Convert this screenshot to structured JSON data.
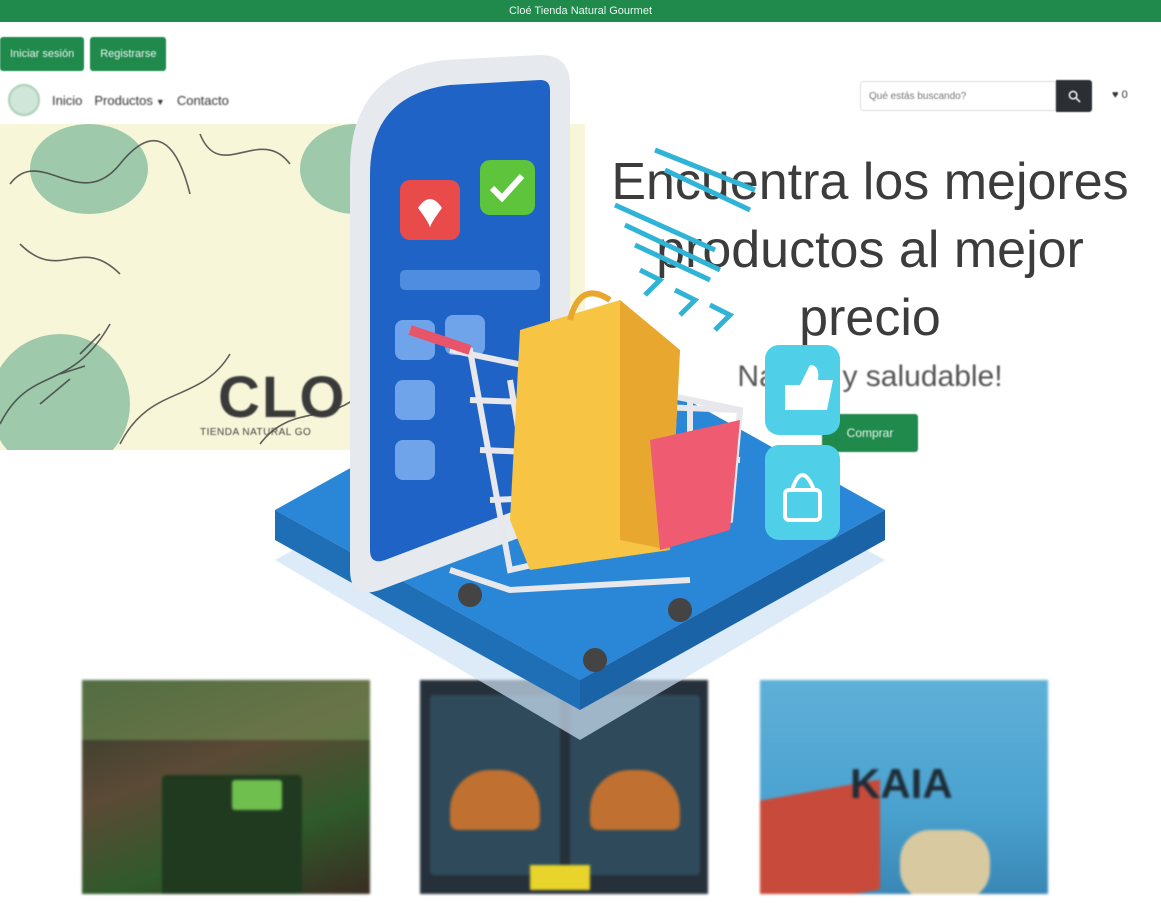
{
  "topbar": {
    "text": "Cloé Tienda Natural Gourmet"
  },
  "auth": {
    "login_label": "Iniciar sesión",
    "register_label": "Registrarse"
  },
  "nav": {
    "items": [
      {
        "label": "Inicio"
      },
      {
        "label": "Productos",
        "has_dropdown": true
      },
      {
        "label": "Contacto"
      }
    ]
  },
  "search": {
    "placeholder": "Qué estás buscando?"
  },
  "cart": {
    "count": "0",
    "icon": "heart-icon"
  },
  "banner": {
    "brand": "CLO",
    "tagline": "TIENDA NATURAL GO"
  },
  "hero": {
    "title": "Encuentra los mejores productos al mejor precio",
    "subtitle": "Natural y saludable!",
    "cta_label": "Comprar"
  },
  "products": [
    {
      "image": "product-photo-green-snack-bag",
      "label": ""
    },
    {
      "image": "product-photo-burger-boxes",
      "label": ""
    },
    {
      "image": "product-photo-kaia-bag",
      "label": "KAIA"
    }
  ],
  "colors": {
    "primary": "#1f8a4c",
    "dark": "#2b2f33",
    "banner_bg": "#f7f6d8"
  }
}
